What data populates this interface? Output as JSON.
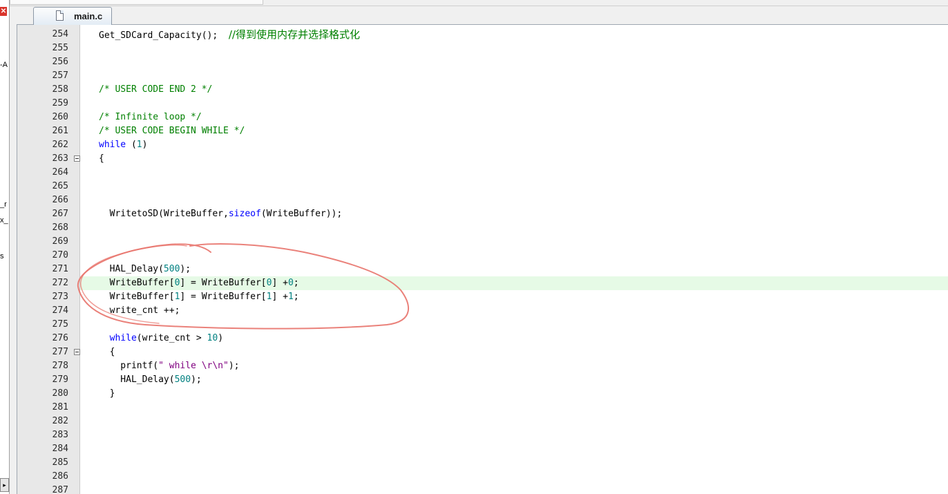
{
  "left_panel": {
    "close_glyph": "✕",
    "fragments": [
      "-A",
      "_r",
      "x_",
      "s"
    ],
    "scroll_glyph": "▸"
  },
  "tab": {
    "label": "main.c"
  },
  "annotation": {
    "color": "#e8736b",
    "shape": "hand-drawn ellipse around lines 271-274"
  },
  "highlight_color": "#e6fae6",
  "lines": [
    {
      "n": "254",
      "fold": false,
      "hl": false,
      "tokens": [
        {
          "t": "Get_SDCard_Capacity();  ",
          "c": ""
        },
        {
          "t": "//得到使用内存并选择格式化",
          "c": "c cn"
        }
      ]
    },
    {
      "n": "255",
      "fold": false,
      "hl": false,
      "tokens": []
    },
    {
      "n": "256",
      "fold": false,
      "hl": false,
      "tokens": []
    },
    {
      "n": "257",
      "fold": false,
      "hl": false,
      "tokens": []
    },
    {
      "n": "258",
      "fold": false,
      "hl": false,
      "tokens": [
        {
          "t": "/* USER CODE END 2 */",
          "c": "c"
        }
      ]
    },
    {
      "n": "259",
      "fold": false,
      "hl": false,
      "tokens": []
    },
    {
      "n": "260",
      "fold": false,
      "hl": false,
      "tokens": [
        {
          "t": "/* Infinite loop */",
          "c": "c"
        }
      ]
    },
    {
      "n": "261",
      "fold": false,
      "hl": false,
      "tokens": [
        {
          "t": "/* USER CODE BEGIN WHILE */",
          "c": "c"
        }
      ]
    },
    {
      "n": "262",
      "fold": false,
      "hl": false,
      "tokens": [
        {
          "t": "while",
          "c": "k"
        },
        {
          "t": " (",
          "c": ""
        },
        {
          "t": "1",
          "c": "n"
        },
        {
          "t": ")",
          "c": ""
        }
      ]
    },
    {
      "n": "263",
      "fold": true,
      "hl": false,
      "tokens": [
        {
          "t": "{",
          "c": ""
        }
      ]
    },
    {
      "n": "264",
      "fold": false,
      "hl": false,
      "tokens": []
    },
    {
      "n": "265",
      "fold": false,
      "hl": false,
      "tokens": []
    },
    {
      "n": "266",
      "fold": false,
      "hl": false,
      "tokens": []
    },
    {
      "n": "267",
      "fold": false,
      "hl": false,
      "tokens": [
        {
          "t": "  WritetoSD(WriteBuffer,",
          "c": ""
        },
        {
          "t": "sizeof",
          "c": "k"
        },
        {
          "t": "(WriteBuffer));",
          "c": ""
        }
      ]
    },
    {
      "n": "268",
      "fold": false,
      "hl": false,
      "tokens": []
    },
    {
      "n": "269",
      "fold": false,
      "hl": false,
      "tokens": []
    },
    {
      "n": "270",
      "fold": false,
      "hl": false,
      "tokens": []
    },
    {
      "n": "271",
      "fold": false,
      "hl": false,
      "tokens": [
        {
          "t": "  HAL_Delay(",
          "c": ""
        },
        {
          "t": "500",
          "c": "n"
        },
        {
          "t": ");",
          "c": ""
        }
      ]
    },
    {
      "n": "272",
      "fold": false,
      "hl": true,
      "tokens": [
        {
          "t": "  WriteBuffer[",
          "c": ""
        },
        {
          "t": "0",
          "c": "n"
        },
        {
          "t": "] = WriteBuffer[",
          "c": ""
        },
        {
          "t": "0",
          "c": "n"
        },
        {
          "t": "] +",
          "c": ""
        },
        {
          "t": "0",
          "c": "n"
        },
        {
          "t": ";",
          "c": ""
        }
      ]
    },
    {
      "n": "273",
      "fold": false,
      "hl": false,
      "tokens": [
        {
          "t": "  WriteBuffer[",
          "c": ""
        },
        {
          "t": "1",
          "c": "n"
        },
        {
          "t": "] = WriteBuffer[",
          "c": ""
        },
        {
          "t": "1",
          "c": "n"
        },
        {
          "t": "] +",
          "c": ""
        },
        {
          "t": "1",
          "c": "n"
        },
        {
          "t": ";",
          "c": ""
        }
      ]
    },
    {
      "n": "274",
      "fold": false,
      "hl": false,
      "tokens": [
        {
          "t": "  write_cnt ++;",
          "c": ""
        }
      ]
    },
    {
      "n": "275",
      "fold": false,
      "hl": false,
      "tokens": []
    },
    {
      "n": "276",
      "fold": false,
      "hl": false,
      "tokens": [
        {
          "t": "  ",
          "c": ""
        },
        {
          "t": "while",
          "c": "k"
        },
        {
          "t": "(write_cnt > ",
          "c": ""
        },
        {
          "t": "10",
          "c": "n"
        },
        {
          "t": ")",
          "c": ""
        }
      ]
    },
    {
      "n": "277",
      "fold": true,
      "hl": false,
      "tokens": [
        {
          "t": "  {",
          "c": ""
        }
      ]
    },
    {
      "n": "278",
      "fold": false,
      "hl": false,
      "tokens": [
        {
          "t": "    printf(",
          "c": ""
        },
        {
          "t": "\" while \\r\\n\"",
          "c": "s"
        },
        {
          "t": ");",
          "c": ""
        }
      ]
    },
    {
      "n": "279",
      "fold": false,
      "hl": false,
      "tokens": [
        {
          "t": "    HAL_Delay(",
          "c": ""
        },
        {
          "t": "500",
          "c": "n"
        },
        {
          "t": ");",
          "c": ""
        }
      ]
    },
    {
      "n": "280",
      "fold": false,
      "hl": false,
      "tokens": [
        {
          "t": "  }",
          "c": ""
        }
      ]
    },
    {
      "n": "281",
      "fold": false,
      "hl": false,
      "tokens": []
    },
    {
      "n": "282",
      "fold": false,
      "hl": false,
      "tokens": []
    },
    {
      "n": "283",
      "fold": false,
      "hl": false,
      "tokens": []
    },
    {
      "n": "284",
      "fold": false,
      "hl": false,
      "tokens": []
    },
    {
      "n": "285",
      "fold": false,
      "hl": false,
      "tokens": []
    },
    {
      "n": "286",
      "fold": false,
      "hl": false,
      "tokens": []
    },
    {
      "n": "287",
      "fold": false,
      "hl": false,
      "tokens": []
    }
  ]
}
